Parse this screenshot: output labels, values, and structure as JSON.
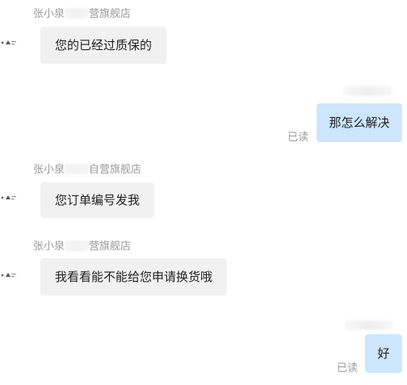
{
  "conversation": [
    {
      "direction": "incoming",
      "sender_prefix": "张小泉",
      "sender_suffix": "营旗舰店",
      "text": "您的已经过质保的"
    },
    {
      "direction": "outgoing",
      "text": "那怎么解决",
      "status": "已读"
    },
    {
      "direction": "incoming",
      "sender_prefix": "张小泉",
      "sender_suffix": "自营旗舰店",
      "text": "您订单编号发我"
    },
    {
      "direction": "incoming",
      "sender_prefix": "张小泉",
      "sender_suffix": "营旗舰店",
      "text": "我看看能不能给您申请换货哦"
    },
    {
      "direction": "outgoing",
      "text": "好",
      "status": "已读"
    }
  ],
  "colors": {
    "incoming_bubble": "#f1f1f1",
    "outgoing_bubble": "#cde6fd",
    "meta_text": "#9a9a9a"
  },
  "icons": {
    "avatar": "shop-avatar-icon"
  }
}
